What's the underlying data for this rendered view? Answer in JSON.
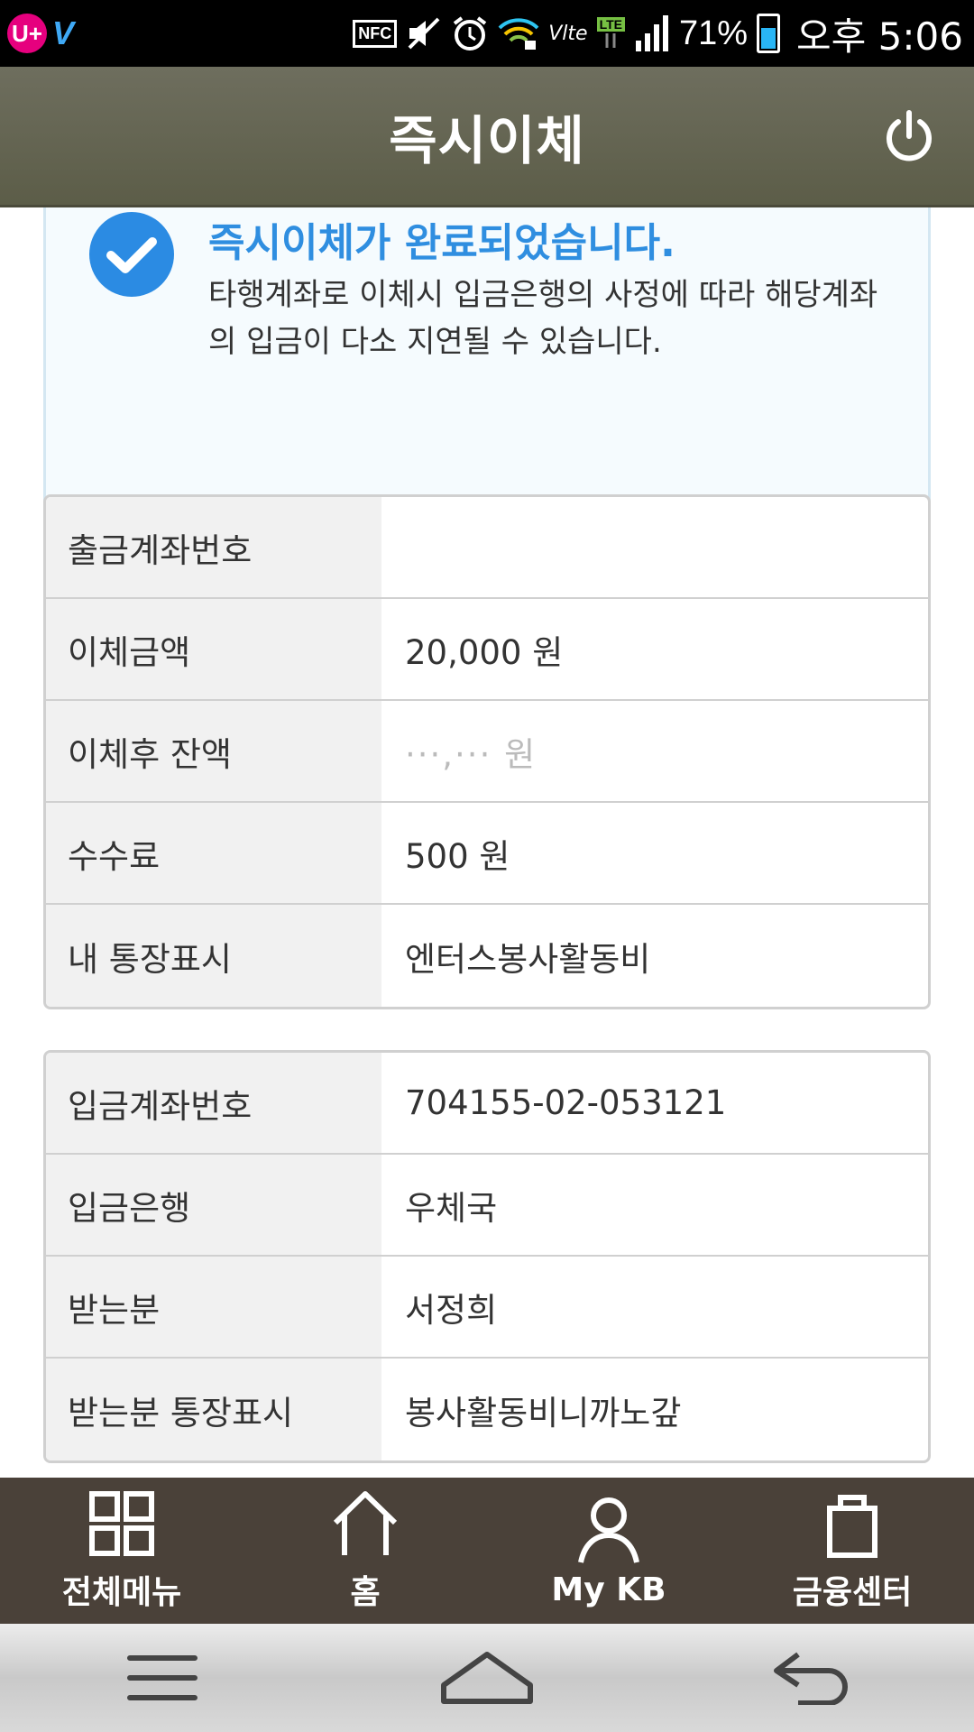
{
  "status_bar": {
    "carrier_logo_text": "U+",
    "network_logo_text": "V",
    "nfc_label": "NFC",
    "volte_label": "Vlte",
    "lte_label": "LTE",
    "battery_percent": "71%",
    "battery_level": 0.71,
    "time": "오후 5:06"
  },
  "header": {
    "title": "즉시이체"
  },
  "notice": {
    "title": "즉시이체가 완료되었습니다.",
    "description": "타행계좌로 이체시 입금은행의 사정에 따라 해당계좌의 입금이 다소 지연될 수 있습니다."
  },
  "transfer_info": [
    {
      "label": "출금계좌번호",
      "value": ""
    },
    {
      "label": "이체금액",
      "value": "20,000 원"
    },
    {
      "label": "이체후 잔액",
      "value": "···,··· 원"
    },
    {
      "label": "수수료",
      "value": "500 원"
    },
    {
      "label": "내 통장표시",
      "value": "엔터스봉사활동비"
    }
  ],
  "recipient_info": [
    {
      "label": "입금계좌번호",
      "value": "704155-02-053121"
    },
    {
      "label": "입금은행",
      "value": "우체국"
    },
    {
      "label": "받는분",
      "value": "서정희"
    },
    {
      "label": "받는분 통장표시",
      "value": "봉사활동비니까노갚"
    }
  ],
  "bottom_nav": [
    {
      "label": "전체메뉴",
      "icon": "grid-menu-icon"
    },
    {
      "label": "홈",
      "icon": "home-icon"
    },
    {
      "label": "My KB",
      "icon": "person-icon"
    },
    {
      "label": "금융센터",
      "icon": "shopping-bag-icon"
    }
  ],
  "colors": {
    "header_bg": "#5c5d48",
    "accent_blue": "#2f8ee0",
    "notice_bg": "#f5fbfe",
    "nav_bg": "#4a4139"
  }
}
